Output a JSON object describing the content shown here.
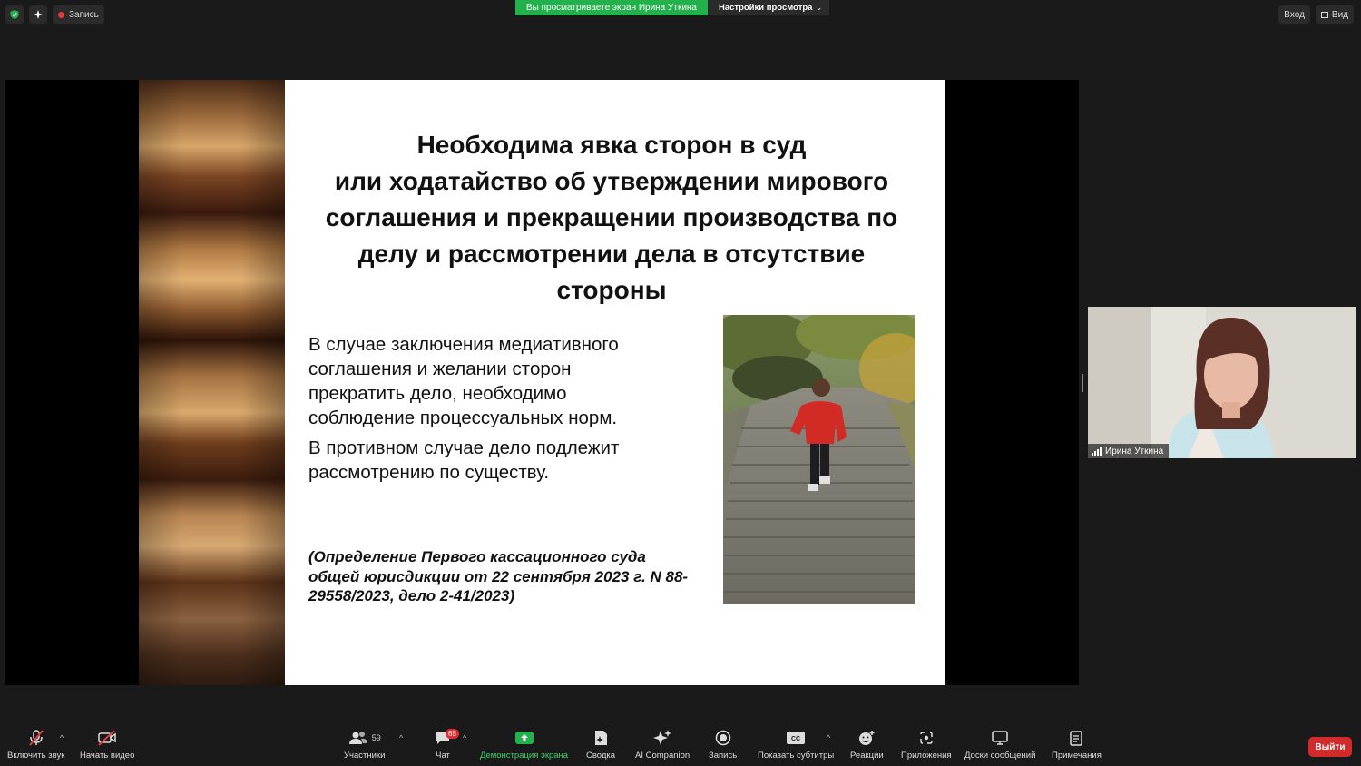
{
  "top_bar": {
    "record_label": "Запись",
    "share_banner": "Вы просматриваете экран Ирина Уткина",
    "view_settings": "Настройки просмотра",
    "enter_label": "Вход",
    "view_label": "Вид",
    "accent_green": "#23b14d"
  },
  "slide": {
    "title_lines": [
      "Необходима явка сторон в суд",
      "или ходатайство об утверждении мирового",
      "соглашения и прекращении производства по",
      "делу и рассмотрении дела в отсутствие",
      "стороны"
    ],
    "para1_lines": [
      "В случае заключения медиативного",
      "соглашения и желании сторон",
      "прекратить дело, необходимо",
      "соблюдение процессуальных норм."
    ],
    "para2_lines": [
      "В противном случае дело подлежит",
      "рассмотрению по существу."
    ],
    "citation_lines": [
      "(Определение Первого кассационного суда",
      "общей юрисдикции от 22 сентября 2023 г. N 88-",
      "29558/2023, дело 2-41/2023)"
    ],
    "photo": "person-running-up-stone-stairs"
  },
  "participant": {
    "name": "Ирина Уткина"
  },
  "toolbar": {
    "mute_label": "Включить звук",
    "video_label": "Начать видео",
    "participants_label": "Участники",
    "participants_count": "59",
    "chat_label": "Чат",
    "chat_badge": "65",
    "share_label": "Демонстрация экрана",
    "summary_label": "Сводка",
    "ai_label": "AI Companion",
    "record_label": "Запись",
    "captions_label": "Показать субтитры",
    "reactions_label": "Реакции",
    "apps_label": "Приложения",
    "whiteboards_label": "Доски сообщений",
    "notes_label": "Примечания",
    "leave_label": "Выйти",
    "leave_color": "#d12b2b"
  }
}
